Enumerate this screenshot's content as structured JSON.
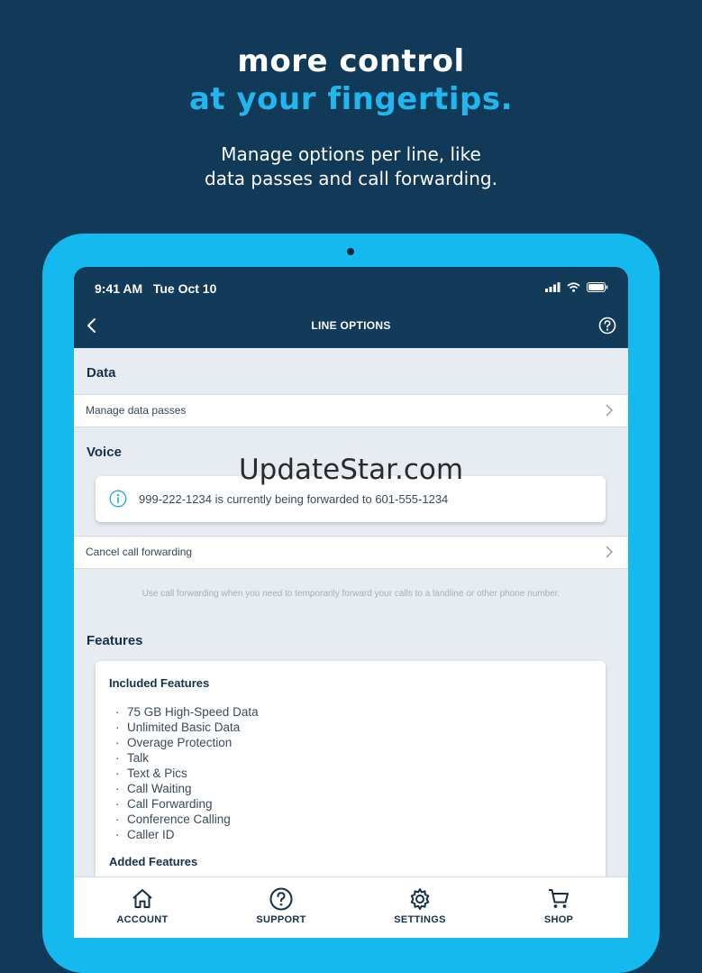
{
  "hero": {
    "line1": "more control",
    "line2": "at your fingertips.",
    "sub1": "Manage options per line, like",
    "sub2": "data passes and call forwarding."
  },
  "status": {
    "time": "9:41 AM   Tue Oct 10"
  },
  "nav": {
    "title": "LINE OPTIONS"
  },
  "data_section": {
    "title": "Data",
    "row_label": "Manage data passes"
  },
  "voice_section": {
    "title": "Voice",
    "info_text": "999-222-1234 is currently being forwarded to 601-555-1234",
    "row_label": "Cancel call forwarding",
    "helper_text": "Use call forwarding when you need to temporarily forward your calls to a landline or other phone number."
  },
  "features_section": {
    "title": "Features",
    "included_title": "Included Features",
    "included": [
      "75 GB High-Speed Data",
      "Unlimited Basic Data",
      "Overage Protection",
      "Talk",
      "Text & Pics",
      "Call Waiting",
      "Call Forwarding",
      "Conference Calling",
      "Caller ID"
    ],
    "added_title": "Added Features"
  },
  "tabs": {
    "account": "ACCOUNT",
    "support": "SUPPORT",
    "settings": "SETTINGS",
    "shop": "SHOP"
  },
  "watermark": "UpdateStar.com",
  "colors": {
    "background": "#103a58",
    "accent": "#21b7ee",
    "tablet_frame": "#14b9ef",
    "navbar": "#123a59"
  }
}
